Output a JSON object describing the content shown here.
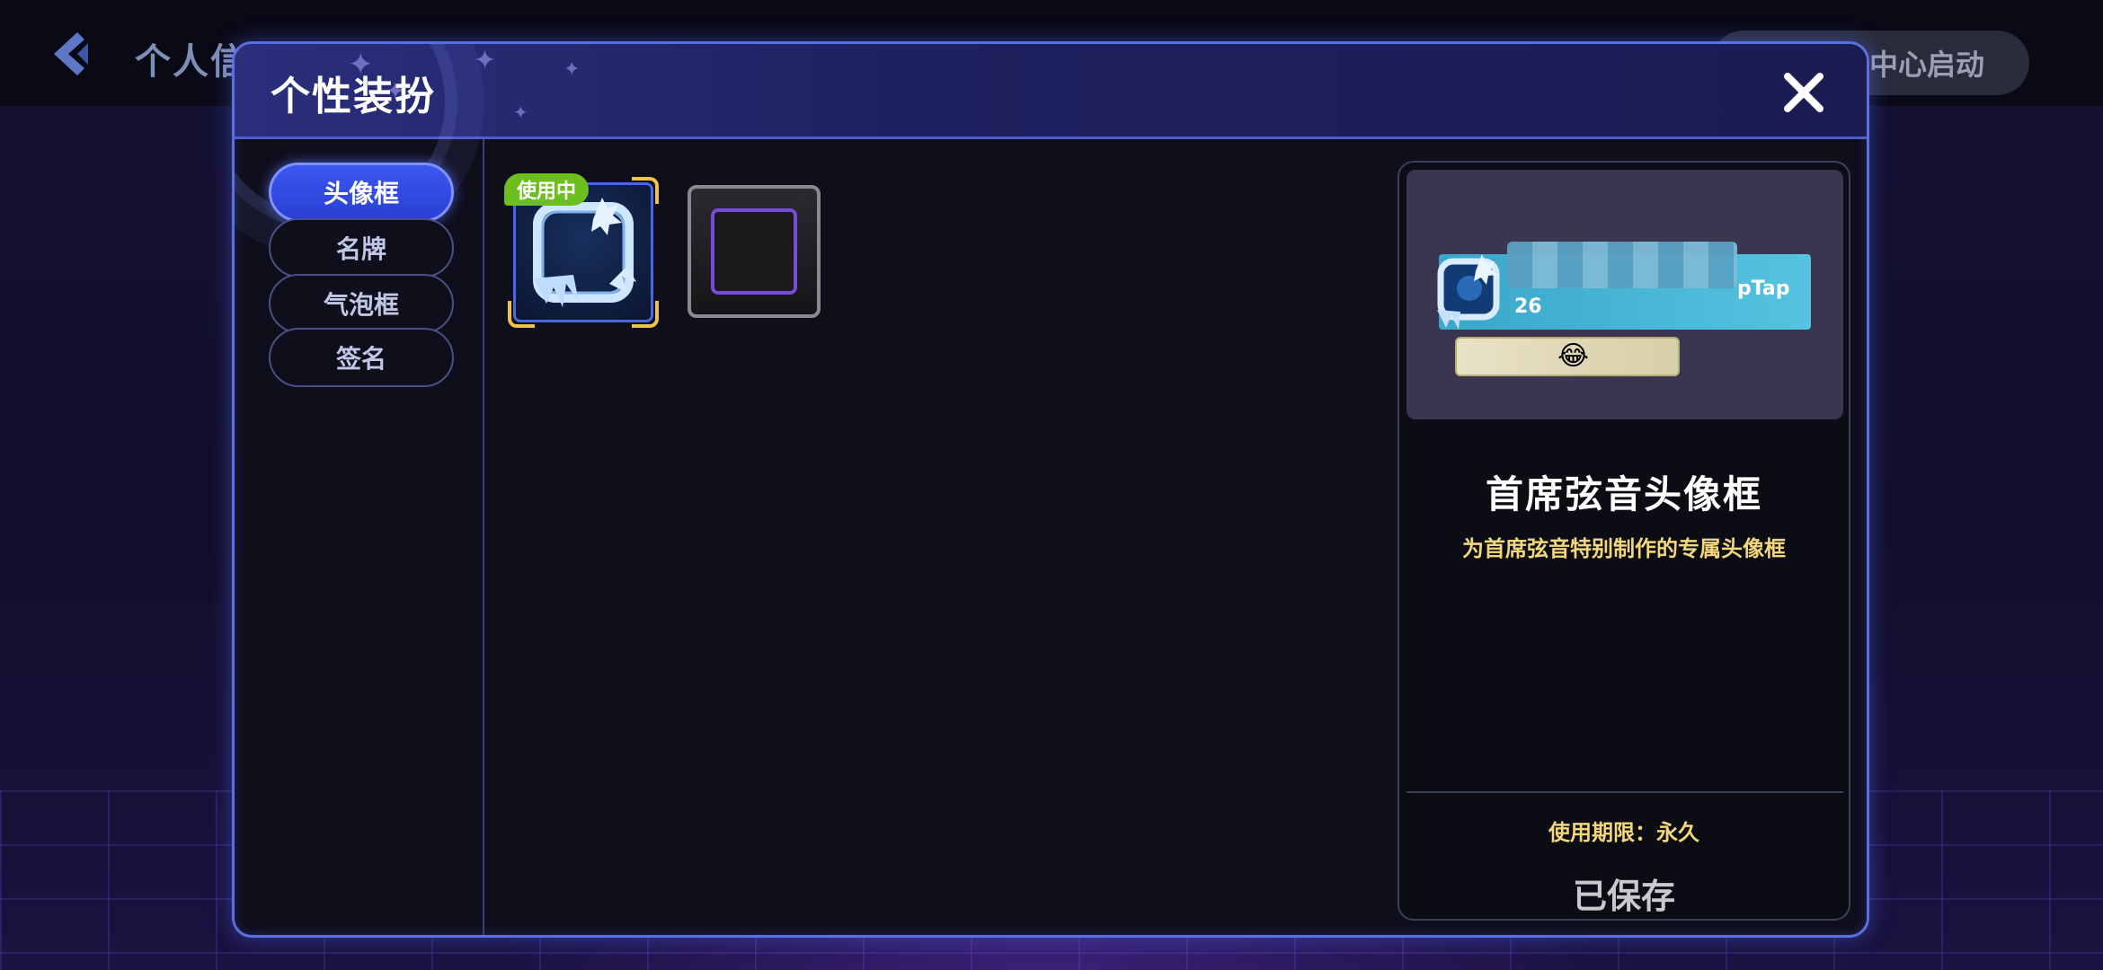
{
  "topbar": {
    "title": "个人信息",
    "right_button": "游戏中心启动"
  },
  "dialog": {
    "title": "个性装扮",
    "tabs": [
      {
        "label": "头像框",
        "active": true
      },
      {
        "label": "名牌",
        "active": false
      },
      {
        "label": "气泡框",
        "active": false
      },
      {
        "label": "签名",
        "active": false
      }
    ],
    "items": [
      {
        "badge": "使用中",
        "selected": true,
        "in_use": true
      },
      {
        "selected": false,
        "in_use": false
      }
    ],
    "preview": {
      "brand_text": "pTap",
      "level_text": "26",
      "emoji": "😂",
      "item_name": "首席弦音头像框",
      "item_description": "为首席弦音特别制作的专属头像框",
      "usage_period": "使用期限：永久",
      "status": "已保存"
    }
  },
  "colors": {
    "accent_blue": "#3b58f0",
    "in_use_green": "#6cbf1e",
    "selected_gold": "#f0c24a",
    "highlight_yellow": "#f3d77a"
  }
}
